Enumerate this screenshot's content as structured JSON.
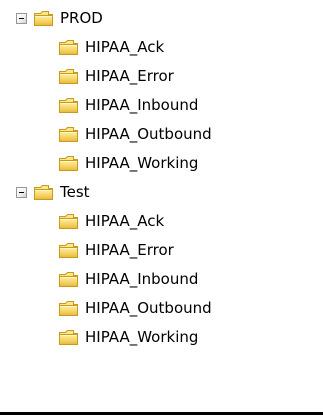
{
  "tree": {
    "groups": [
      {
        "label": "PROD",
        "expanded": true,
        "children": [
          {
            "label": "HIPAA_Ack"
          },
          {
            "label": "HIPAA_Error"
          },
          {
            "label": "HIPAA_Inbound"
          },
          {
            "label": "HIPAA_Outbound"
          },
          {
            "label": "HIPAA_Working"
          }
        ]
      },
      {
        "label": "Test",
        "expanded": true,
        "children": [
          {
            "label": "HIPAA_Ack"
          },
          {
            "label": "HIPAA_Error"
          },
          {
            "label": "HIPAA_Inbound"
          },
          {
            "label": "HIPAA_Outbound"
          },
          {
            "label": "HIPAA_Working"
          }
        ]
      }
    ],
    "icons": {
      "expander": "minus-box-icon",
      "folder": "folder-icon"
    },
    "colors": {
      "folder_body": "#f5d567",
      "folder_outline": "#c99a1c",
      "expander_border": "#919b9c",
      "rule": "#000000"
    }
  }
}
